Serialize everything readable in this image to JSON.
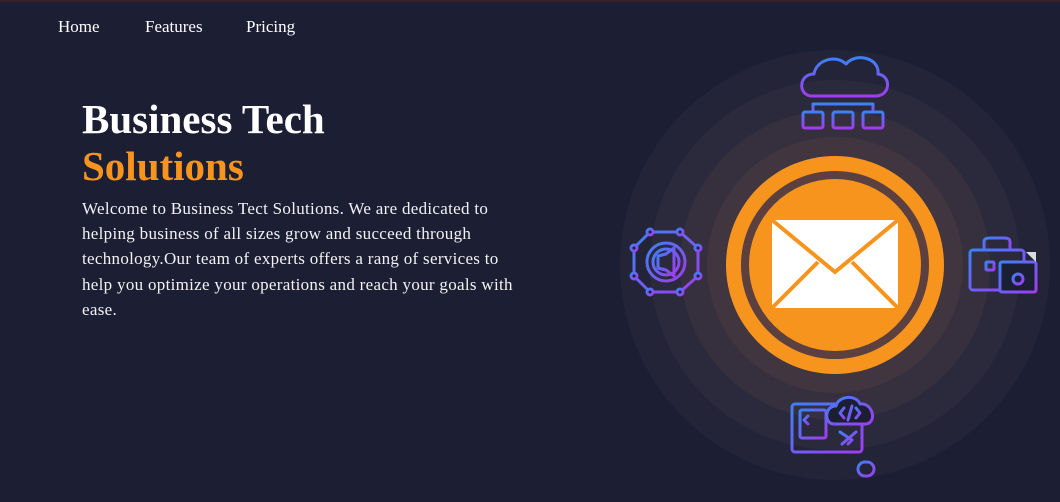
{
  "nav": {
    "items": [
      {
        "label": "Home"
      },
      {
        "label": "Features"
      },
      {
        "label": "Pricing"
      }
    ]
  },
  "hero": {
    "title_line1": "Business Tech",
    "title_line2": "Solutions",
    "description": "Welcome to Business Tect Solutions. We are dedicated to helping business of all sizes grow and succeed through technology.Our team of experts offers a rang of services to help you optimize your operations and reach your goals with ease."
  },
  "colors": {
    "background": "#1c1e34",
    "accent": "#f7941d",
    "text": "#ffffff",
    "icon_gradient_start": "#3b82f6",
    "icon_gradient_end": "#a03cf0"
  },
  "icons": {
    "center": "envelope-icon",
    "top": "cloud-network-icon",
    "left": "marketing-megaphone-icon",
    "right": "briefcase-money-icon",
    "bottom": "code-monitor-icon"
  }
}
